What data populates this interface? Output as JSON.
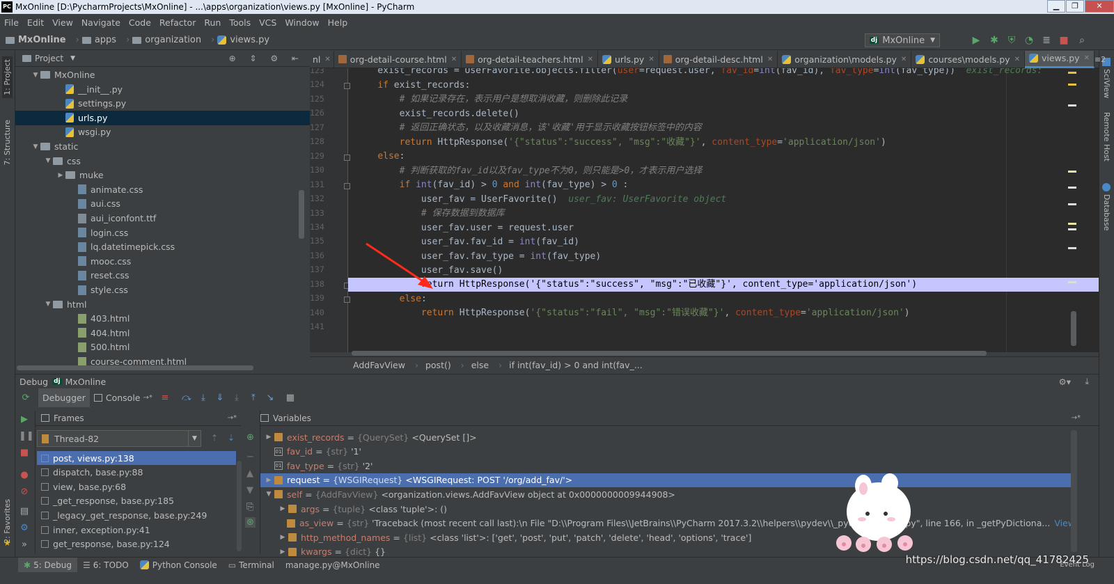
{
  "window": {
    "title": "MxOnline [D:\\PycharmProjects\\MxOnline] - ...\\apps\\organization\\views.py [MxOnline] - PyCharm",
    "logo_text": "PC"
  },
  "menu": [
    "File",
    "Edit",
    "View",
    "Navigate",
    "Code",
    "Refactor",
    "Run",
    "Tools",
    "VCS",
    "Window",
    "Help"
  ],
  "navbar": {
    "crumbs": [
      "MxOnline",
      "apps",
      "organization",
      "views.py"
    ],
    "run_config": "MxOnline",
    "dj": "dj"
  },
  "left_stripe": {
    "project": "1: Project",
    "structure": "7: Structure",
    "favorites": "2: Favorites"
  },
  "right_stripe": {
    "sciview": "SciView",
    "remote_host": "Remote Host",
    "database": "Database"
  },
  "project_panel": {
    "title": "Project",
    "items": [
      {
        "label": "MxOnline",
        "kind": "dir",
        "depth": 1,
        "expanded": true
      },
      {
        "label": "__init__.py",
        "kind": "py",
        "depth": 3
      },
      {
        "label": "settings.py",
        "kind": "py",
        "depth": 3
      },
      {
        "label": "urls.py",
        "kind": "py",
        "depth": 3,
        "selected": true
      },
      {
        "label": "wsgi.py",
        "kind": "py",
        "depth": 3
      },
      {
        "label": "static",
        "kind": "dir",
        "depth": 1,
        "expanded": true
      },
      {
        "label": "css",
        "kind": "dir",
        "depth": 2,
        "expanded": true
      },
      {
        "label": "muke",
        "kind": "dir",
        "depth": 3,
        "expanded": false
      },
      {
        "label": "animate.css",
        "kind": "css",
        "depth": 4
      },
      {
        "label": "aui.css",
        "kind": "css",
        "depth": 4
      },
      {
        "label": "aui_iconfont.ttf",
        "kind": "ttf",
        "depth": 4
      },
      {
        "label": "login.css",
        "kind": "css",
        "depth": 4
      },
      {
        "label": "lq.datetimepick.css",
        "kind": "css",
        "depth": 4
      },
      {
        "label": "mooc.css",
        "kind": "css",
        "depth": 4
      },
      {
        "label": "reset.css",
        "kind": "css",
        "depth": 4
      },
      {
        "label": "style.css",
        "kind": "css",
        "depth": 4
      },
      {
        "label": "html",
        "kind": "dir",
        "depth": 2,
        "expanded": true
      },
      {
        "label": "403.html",
        "kind": "html",
        "depth": 4
      },
      {
        "label": "404.html",
        "kind": "html",
        "depth": 4
      },
      {
        "label": "500.html",
        "kind": "html",
        "depth": 4
      },
      {
        "label": "course-comment.html",
        "kind": "html",
        "depth": 4
      }
    ]
  },
  "tabs": [
    {
      "label": "org-detail-course.html",
      "kind": "html"
    },
    {
      "label": "org-detail-teachers.html",
      "kind": "html"
    },
    {
      "label": "urls.py",
      "kind": "py"
    },
    {
      "label": "org-detail-desc.html",
      "kind": "html"
    },
    {
      "label": "organization\\models.py",
      "kind": "py"
    },
    {
      "label": "courses\\models.py",
      "kind": "py"
    },
    {
      "label": "views.py",
      "kind": "py",
      "active": true
    }
  ],
  "tabs_overflow": "≡2",
  "tabs_left_fragment": "nl",
  "editor": {
    "line_numbers": [
      "123",
      "124",
      "125",
      "126",
      "127",
      "128",
      "129",
      "130",
      "131",
      "132",
      "133",
      "134",
      "135",
      "136",
      "137",
      "138",
      "139",
      "140",
      "141"
    ],
    "current_line": "138",
    "hint_user_fav": "user_fav: UserFavorite object",
    "hint_exist_records": "exist_records:"
  },
  "breadcrumb": [
    "AddFavView",
    "post()",
    "else",
    "if int(fav_id) > 0 and int(fav_..."
  ],
  "debug": {
    "title": "Debug",
    "config": "MxOnline",
    "tabs": {
      "debugger": "Debugger",
      "console": "Console"
    },
    "frames_title": "Frames",
    "thread": "Thread-82",
    "frames": [
      {
        "label": "post, views.py:138",
        "selected": true
      },
      {
        "label": "dispatch, base.py:88"
      },
      {
        "label": "view, base.py:68"
      },
      {
        "label": "_get_response, base.py:185"
      },
      {
        "label": "_legacy_get_response, base.py:249"
      },
      {
        "label": "inner, exception.py:41"
      },
      {
        "label": "get_response, base.py:124"
      }
    ],
    "variables_title": "Variables",
    "variables": [
      {
        "name": "exist_records",
        "type": "{QuerySet}",
        "value": "<QuerySet []>",
        "icon": "obj",
        "expandable": true,
        "depth": 0
      },
      {
        "name": "fav_id",
        "type": "{str}",
        "value": "'1'",
        "icon": "prim",
        "expandable": false,
        "depth": 0
      },
      {
        "name": "fav_type",
        "type": "{str}",
        "value": "'2'",
        "icon": "prim",
        "expandable": false,
        "depth": 0
      },
      {
        "name": "request",
        "type": "{WSGIRequest}",
        "value": "<WSGIRequest: POST '/org/add_fav/'>",
        "icon": "obj",
        "expandable": true,
        "depth": 0,
        "selected": true
      },
      {
        "name": "self",
        "type": "{AddFavView}",
        "value": "<organization.views.AddFavView object at 0x0000000009944908>",
        "icon": "obj",
        "expandable": true,
        "expanded": true,
        "depth": 0
      },
      {
        "name": "args",
        "type": "{tuple}",
        "value": "<class 'tuple'>: ()",
        "icon": "obj",
        "expandable": true,
        "depth": 1
      },
      {
        "name": "as_view",
        "type": "{str}",
        "value": "'Traceback (most recent call last):\\n  File \"D:\\\\Program Files\\\\JetBrains\\\\PyCharm 2017.3.2\\\\helpers\\\\pydev\\\\_pydevd_bundle\\\\",
        "value_tail": "ver.py\", line 166, in _getPyDictiona...",
        "view": "View",
        "icon": "obj",
        "expandable": false,
        "depth": 1
      },
      {
        "name": "http_method_names",
        "type": "{list}",
        "value": "<class 'list'>: ['get', 'post', 'put', 'patch', 'delete', 'head', 'options', 'trace']",
        "icon": "obj",
        "expandable": true,
        "depth": 1
      },
      {
        "name": "kwargs",
        "type": "{dict}",
        "value": "{}",
        "icon": "obj",
        "expandable": true,
        "depth": 1
      }
    ]
  },
  "statusbar": {
    "debug": "5: Debug",
    "todo": "6: TODO",
    "python_console": "Python Console",
    "terminal": "Terminal",
    "manage": "manage.py@MxOnline",
    "event_log": "Event Log"
  },
  "watermark": "https://blog.csdn.net/qq_41782425",
  "colors": {
    "accent": "#4a88c7",
    "selection": "#4b6eaf",
    "highlight_line": "#c6c6ff",
    "arrow": "#ff2a1a"
  }
}
